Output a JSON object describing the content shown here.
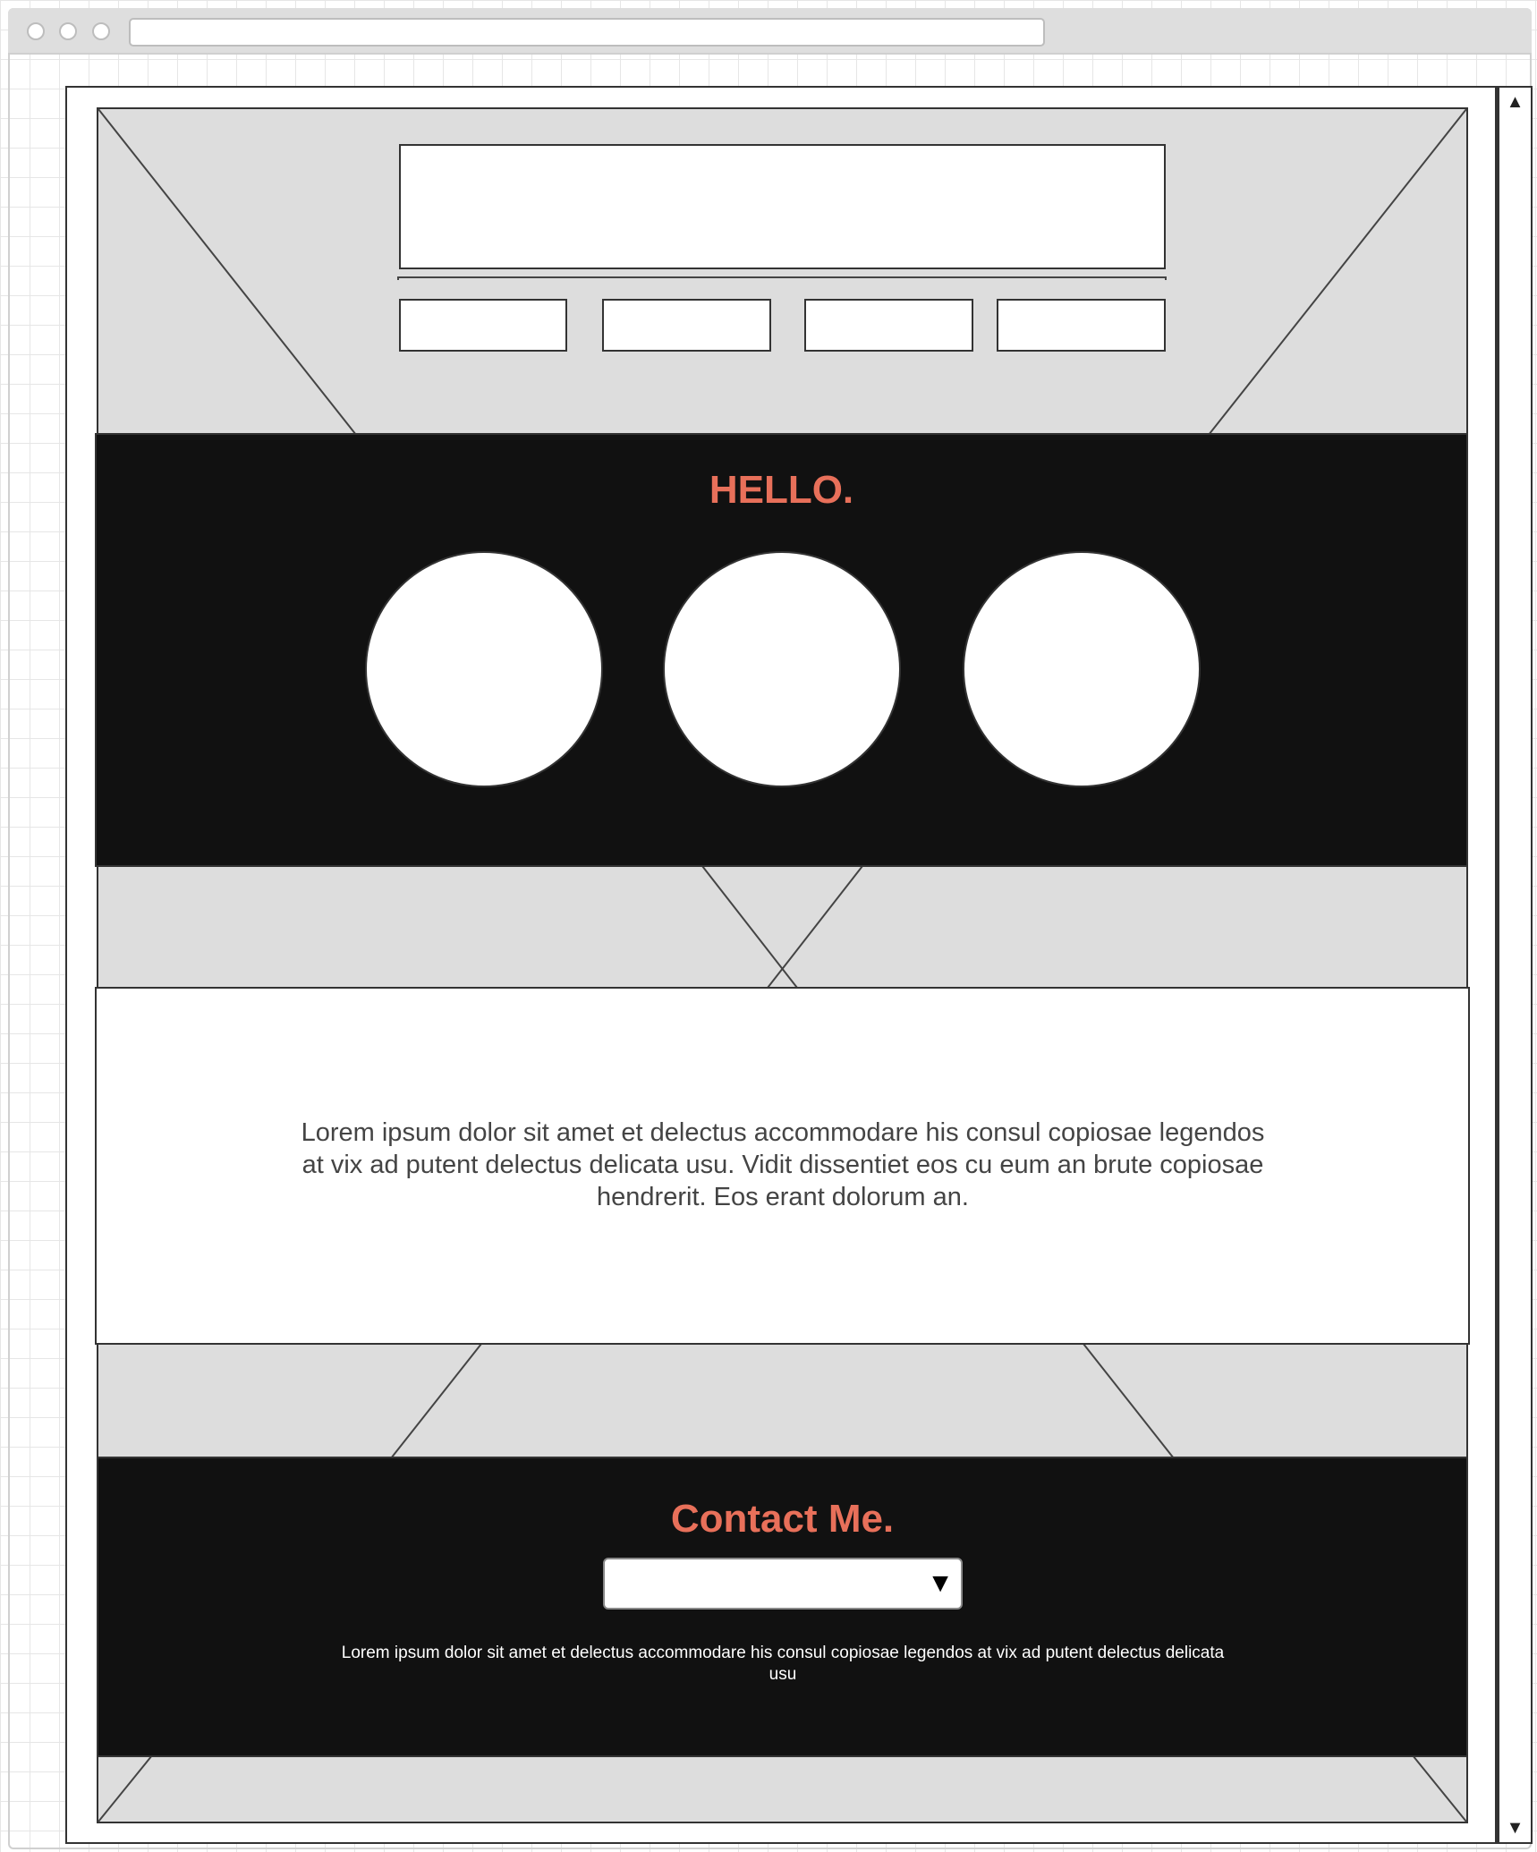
{
  "window": {
    "controls": [
      "close-dot",
      "minimize-dot",
      "maximize-dot"
    ],
    "address": ""
  },
  "hero": {
    "nav_buttons": [
      "",
      "",
      "",
      ""
    ]
  },
  "intro": {
    "heading": "HELLO."
  },
  "about": {
    "text": "Lorem ipsum dolor sit amet et delectus accommodare his consul copiosae legendos at vix ad putent delectus delicata usu. Vidit dissentiet eos cu eum an brute copiosae hendrerit. Eos erant dolorum an."
  },
  "contact": {
    "heading": "Contact Me.",
    "select_value": "",
    "select_arrow": "▼",
    "text": "Lorem ipsum dolor sit amet et delectus accommodare his consul copiosae legendos at vix ad putent delectus delicata usu"
  },
  "scrollbar": {
    "up_arrow": "▲",
    "down_arrow": "▼"
  },
  "colors": {
    "accent": "#e8705a",
    "dark_band": "#111111",
    "placeholder_gray": "#dddddd"
  }
}
